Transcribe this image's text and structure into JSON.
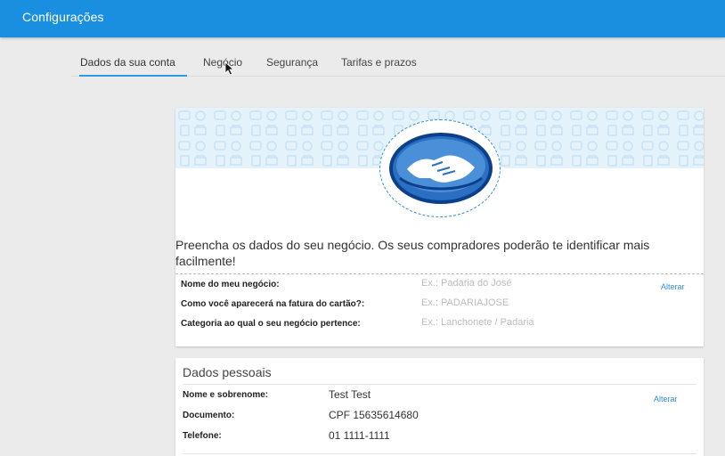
{
  "header": {
    "title": "Configurações",
    "color": "#1a8fe0"
  },
  "tabs": [
    {
      "label": "Dados da sua conta",
      "active": true
    },
    {
      "label": "Negócio",
      "active": false
    },
    {
      "label": "Segurança",
      "active": false
    },
    {
      "label": "Tarifas e prazos",
      "active": false
    }
  ],
  "business": {
    "intro": "Preencha os dados do seu negócio. Os seus compradores poderão te identificar mais facilmente!",
    "rows": [
      {
        "label": "Nome do meu negócio:",
        "placeholder": "Ex.: Padaria do José"
      },
      {
        "label": "Como você aparecerá na fatura do cartão?:",
        "placeholder": "Ex.: PADARIAJOSE"
      },
      {
        "label": "Categoria ao qual o seu negócio pertence:",
        "placeholder": "Ex.: Lanchonete / Padaria"
      }
    ],
    "edit_label": "Alterar",
    "logo_icon": "handshake-logo-icon"
  },
  "personal": {
    "title": "Dados pessoais",
    "rows": [
      {
        "label": "Nome e sobrenome:",
        "value": "Test Test"
      },
      {
        "label": "Documento:",
        "value": "CPF 15635614680"
      },
      {
        "label": "Telefone:",
        "value": "01 1111-1111"
      }
    ],
    "edit_label": "Alterar"
  },
  "colors": {
    "accent": "#2d9ae8",
    "link": "#2d8fdc",
    "banner": "#e4f2fb"
  }
}
